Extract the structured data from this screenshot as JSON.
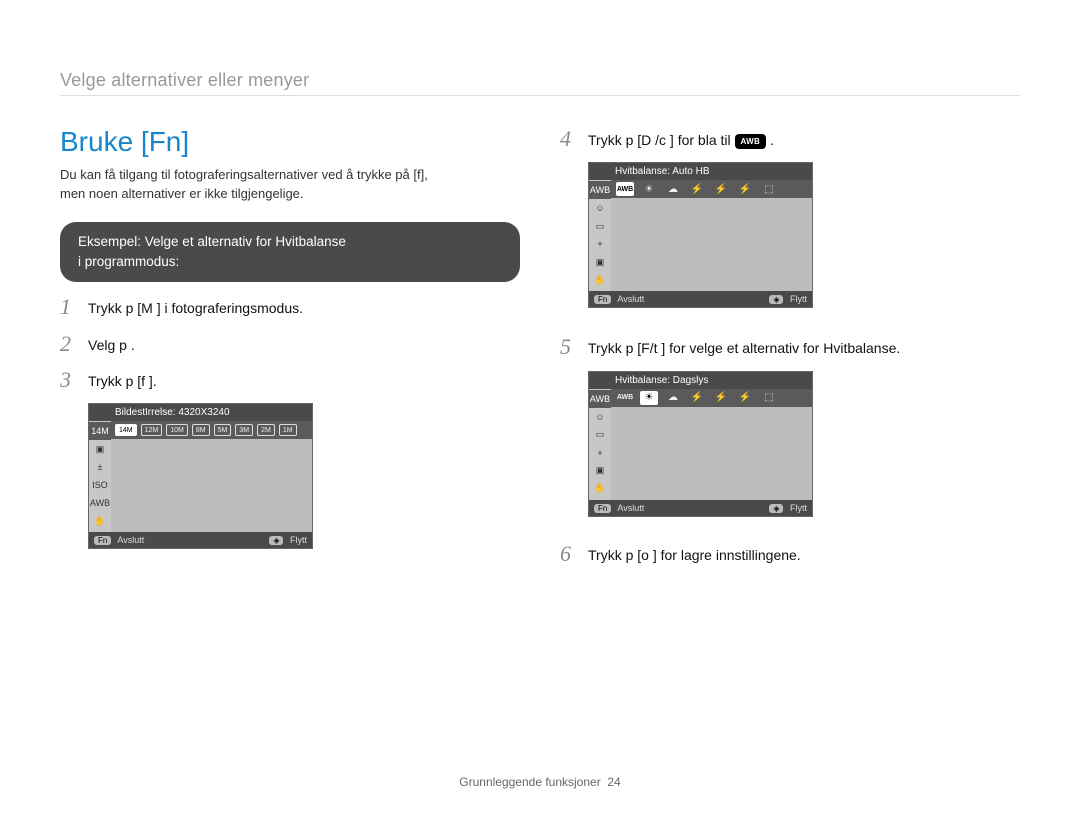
{
  "breadcrumb": "Velge alternativer eller menyer",
  "title": "Bruke [Fn]",
  "intro_line1": "Du kan få tilgang til fotograferingsalternativer ved å trykke på [f],",
  "intro_line2": "men noen alternativer er ikke tilgjengelige.",
  "callout_line1": "Eksempel: Velge et alternativ for Hvitbalanse",
  "callout_line2": "i programmodus:",
  "steps_left": [
    {
      "n": "1",
      "text": "Trykk p  [M       ] i fotograferingsmodus."
    },
    {
      "n": "2",
      "text": "Velg p    ."
    },
    {
      "n": "3",
      "text": "Trykk p  [f   ]."
    }
  ],
  "steps_right": [
    {
      "n": "4",
      "text": "Trykk p  [D      /c   ] for   bla til ",
      "trailing_badge": "AWB",
      "trailing_dot": "."
    },
    {
      "n": "5",
      "text": "Trykk p  [F/t   ] for   velge et alternativ for Hvitbalanse."
    },
    {
      "n": "6",
      "text": "Trykk p  [o   ] for   lagre innstillingene."
    }
  ],
  "lcd1": {
    "top": "BildestIrrelse: 4320X3240",
    "chips": [
      "14M",
      "12M",
      "10M",
      "8M",
      "5M",
      "3M",
      "2M",
      "1M"
    ],
    "bottom_left_btn": "Fn",
    "bottom_left": "Avslutt",
    "bottom_right": "Flytt"
  },
  "lcd2": {
    "top": "Hvitbalanse: Auto HB",
    "wb_icons": [
      "AWB",
      "☀",
      "☁",
      "⚡",
      "⚡",
      "⚡",
      "⬚"
    ],
    "bottom_left_btn": "Fn",
    "bottom_left": "Avslutt",
    "bottom_right": "Flytt"
  },
  "lcd3": {
    "top": "Hvitbalanse: Dagslys",
    "wb_icons": [
      "AWB",
      "☀",
      "☁",
      "⚡",
      "⚡",
      "⚡",
      "⬚"
    ],
    "bottom_left_btn": "Fn",
    "bottom_left": "Avslutt",
    "bottom_right": "Flytt"
  },
  "footer_label": "Grunnleggende funksjoner",
  "footer_page": "24"
}
